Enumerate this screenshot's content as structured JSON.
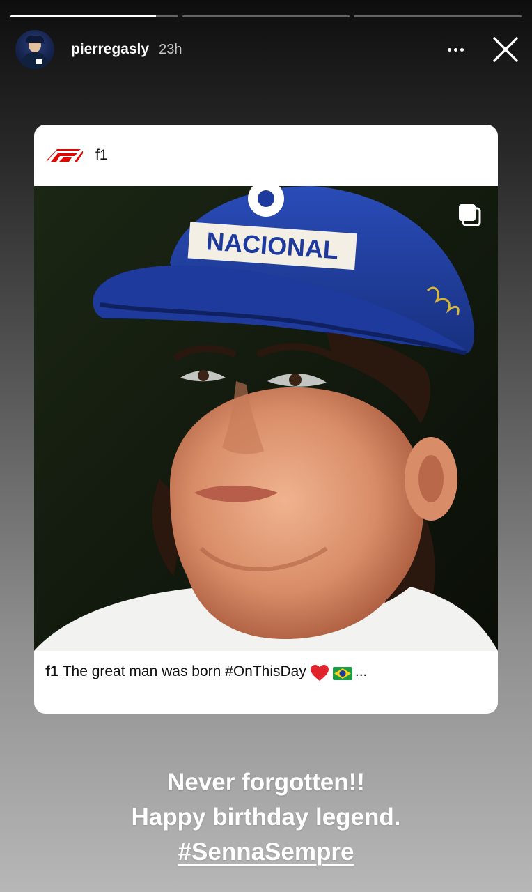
{
  "story": {
    "progress": [
      {
        "state": "viewing",
        "fraction": 0.87
      },
      {
        "state": "upcoming",
        "fraction": 0
      },
      {
        "state": "upcoming",
        "fraction": 0
      }
    ],
    "username": "pierregasly",
    "time_ago": "23h"
  },
  "icons": {
    "more": "more-horizontal-icon",
    "close": "close-x-icon",
    "multi": "multiple-photos-icon",
    "heart": "red-heart-icon",
    "flag": "brazil-flag-icon",
    "brand_logo": "f1-logo"
  },
  "post": {
    "author": "f1",
    "caption_user": "f1",
    "caption_text": "The great man was born #OnThisDay",
    "caption_ellipsis": "..."
  },
  "overlay": {
    "line1": "Never forgotten!!",
    "line2": "Happy birthday legend.",
    "hashtag": "#SennaSempre"
  },
  "photo": {
    "cap_text": "NACIONAL"
  },
  "colors": {
    "f1_red": "#e10600",
    "cap_blue": "#1e3a9a",
    "heart_red": "#e0242b"
  }
}
